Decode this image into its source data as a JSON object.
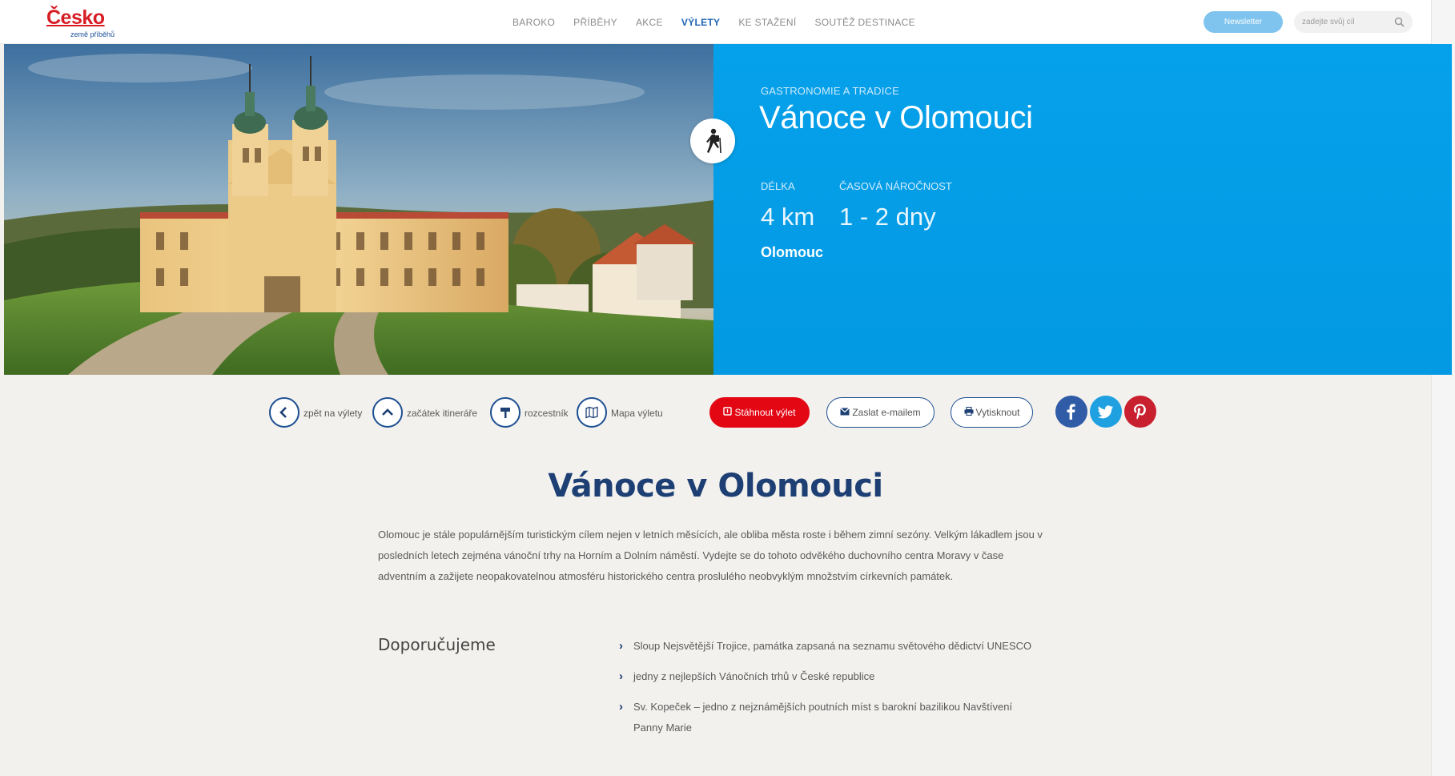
{
  "logo": {
    "main": "Česko",
    "sub": "země příběhů"
  },
  "nav": [
    {
      "label": "BAROKO",
      "active": false
    },
    {
      "label": "PŘÍBĚHY",
      "active": false
    },
    {
      "label": "AKCE",
      "active": false
    },
    {
      "label": "VÝLETY",
      "active": true
    },
    {
      "label": "KE STAŽENÍ",
      "active": false
    },
    {
      "label": "SOUTĚŽ DESTINACE",
      "active": false
    }
  ],
  "header": {
    "newsletter_label": "Newsletter",
    "search_placeholder": "zadejte svůj cíl"
  },
  "hero": {
    "category": "GASTRONOMIE A TRADICE",
    "title": "Vánoce v Olomouci",
    "length_label": "DÉLKA",
    "length_value": "4 km",
    "time_label": "ČASOVÁ NÁROČNOST",
    "time_value": "1 - 2 dny",
    "city": "Olomouc",
    "accent_color": "#039be5"
  },
  "actions": {
    "back": "zpět na výlety",
    "start": "začátek itineráře",
    "signpost": "rozcestník",
    "map": "Mapa výletu",
    "download": "Stáhnout výlet",
    "email": "Zaslat e-mailem",
    "print": "Vytisknout"
  },
  "content": {
    "title": "Vánoce v Olomouci",
    "intro": "Olomouc je stále populárnějším turistickým cílem nejen v letních měsících, ale obliba města roste i během zimní sezóny. Velkým lákadlem jsou v posledních letech zejména vánoční trhy na Horním a Dolním náměstí. Vydejte se do tohoto odvěkého duchovního centra Moravy v čase adventním a zažijete neopakovatelnou atmosféru historického centra proslulého neobvyklým množstvím církevních památek.",
    "recommend_heading": "Doporučujeme",
    "recommend": [
      "Sloup Nejsvětější Trojice, památka zapsaná na seznamu světového dědictví UNESCO",
      "jedny z nejlepších Vánočních trhů v České republice",
      "Sv. Kopeček – jedno z nejznámějších poutních míst s barokní bazilikou Navštívení Panny Marie"
    ]
  },
  "icons": {
    "hiker": "hiker-icon",
    "back": "chevron-left-icon",
    "start": "chevron-up-icon",
    "signpost": "signpost-icon",
    "map": "map-icon",
    "download": "download-icon",
    "email": "mail-icon",
    "print": "printer-icon",
    "facebook": "facebook-icon",
    "twitter": "twitter-icon",
    "pinterest": "pinterest-icon"
  }
}
